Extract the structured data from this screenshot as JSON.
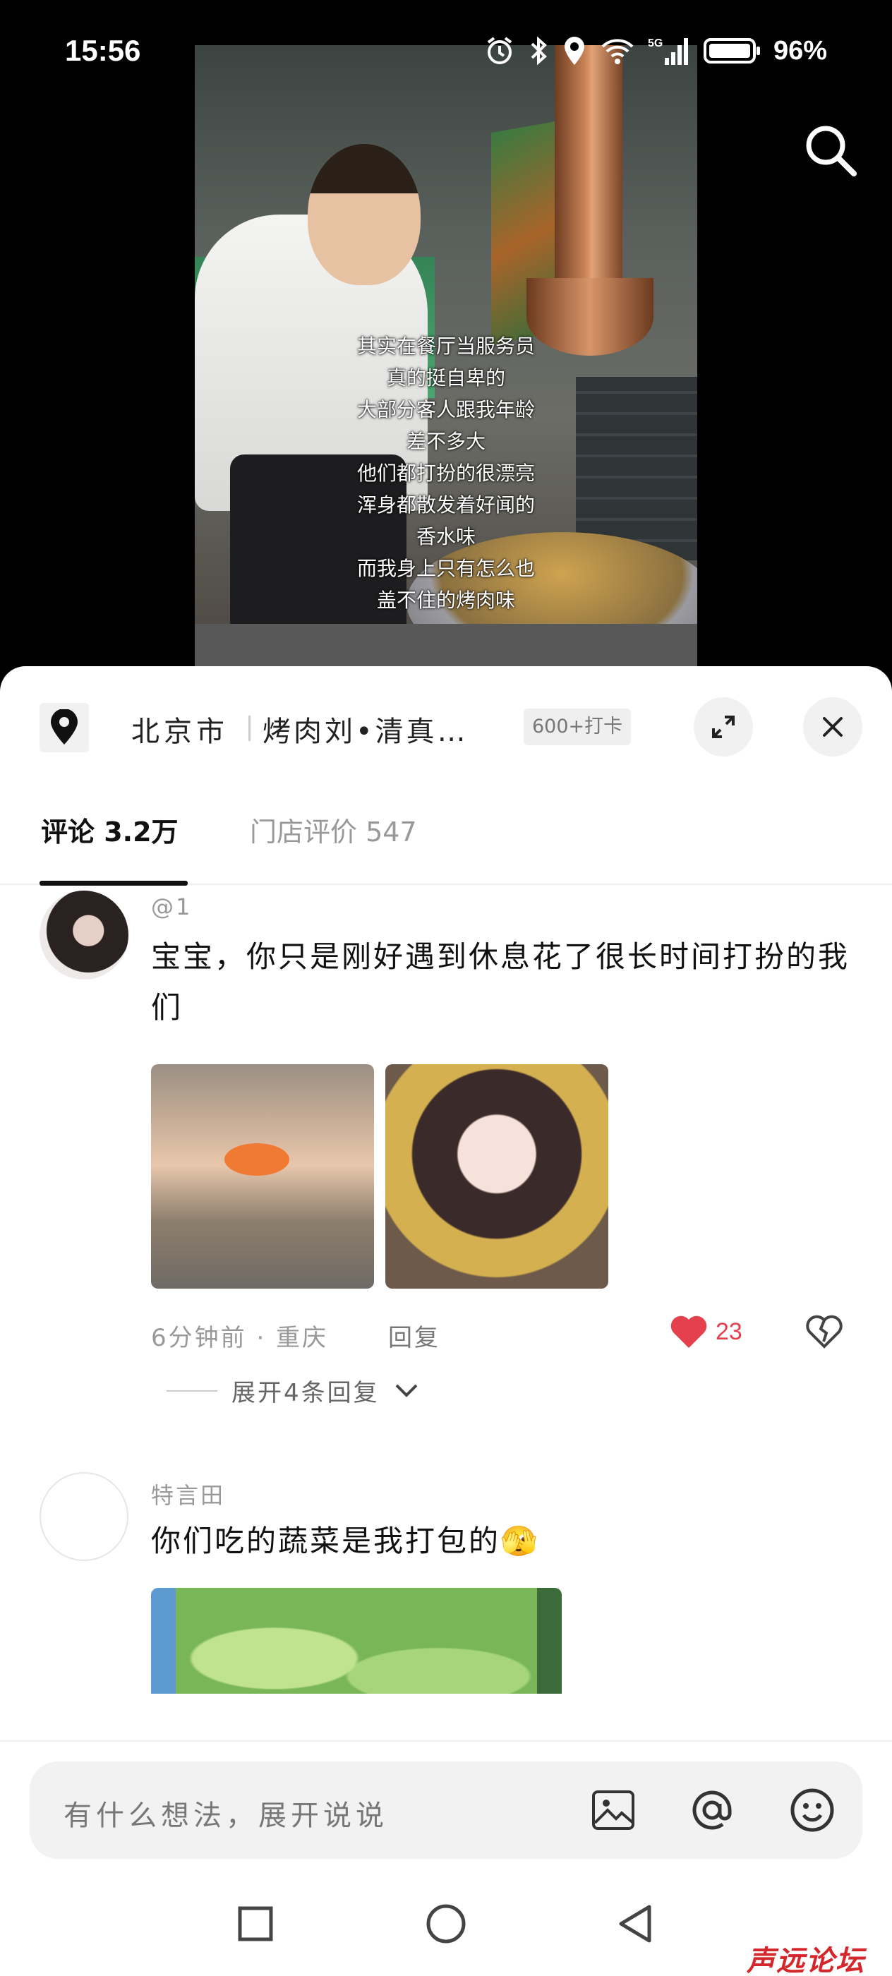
{
  "status_bar": {
    "time": "15:56",
    "network": "5G",
    "battery": "96%"
  },
  "video": {
    "caption_lines": [
      "其实在餐厅当服务员",
      "真的挺自卑的",
      "大部分客人跟我年龄",
      "差不多大",
      "他们都打扮的很漂亮",
      "浑身都散发着好闻的",
      "香水味",
      "而我身上只有怎么也",
      "盖不住的烤肉味"
    ]
  },
  "location": {
    "city": "北京市",
    "shop": "烤肉刘•清真…",
    "badge": "600+打卡"
  },
  "tabs": [
    {
      "label": "评论 3.2万",
      "active": true
    },
    {
      "label": "门店评价 547",
      "active": false
    }
  ],
  "comments": [
    {
      "user": "@1",
      "text": "宝宝，你只是刚好遇到休息花了很长时间打扮的我们",
      "time_location": "6分钟前 · 重庆",
      "reply_label": "回复",
      "likes": "23",
      "expand_label": "展开4条回复"
    },
    {
      "user": "特言田",
      "text": "你们吃的蔬菜是我打包的🫣"
    }
  ],
  "input": {
    "placeholder": "有什么想法，展开说说"
  },
  "watermark": "声远论坛",
  "colors": {
    "like": "#e5404e",
    "watermark": "#d4272c"
  }
}
